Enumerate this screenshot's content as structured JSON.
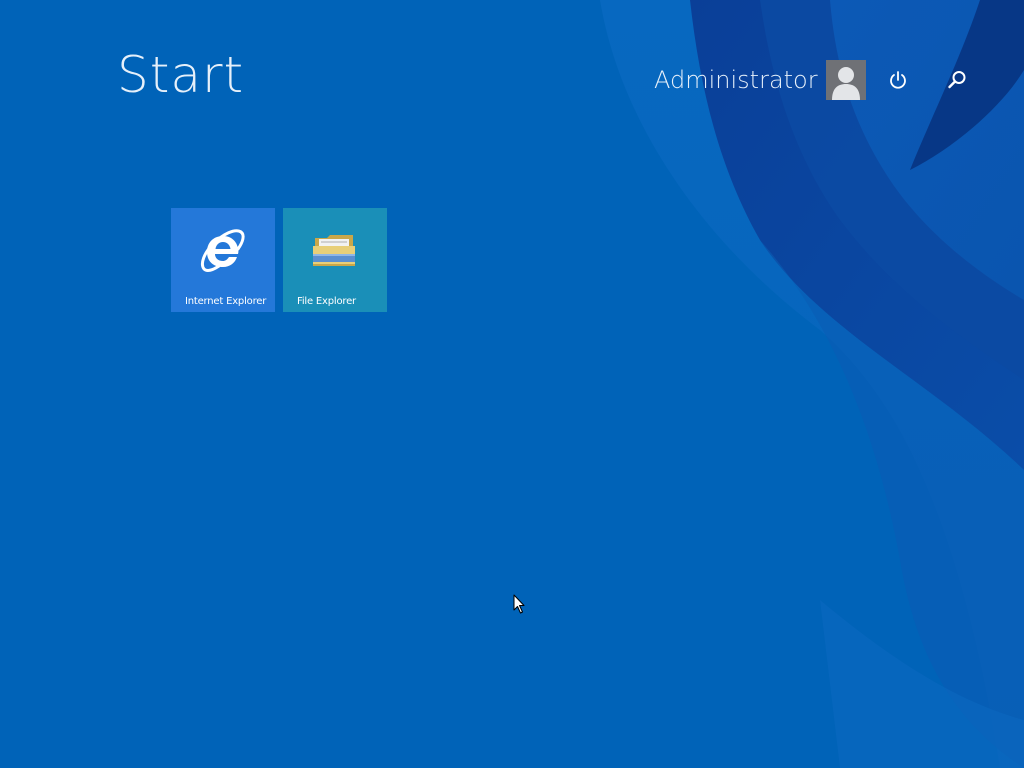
{
  "screen": {
    "title": "Start",
    "background_color": "#0063b8",
    "accent_ribbon_color": "#003a8c"
  },
  "user": {
    "name": "Administrator",
    "avatar_icon": "user-silhouette-icon"
  },
  "top_buttons": {
    "power_icon": "power-icon",
    "search_icon": "search-icon"
  },
  "tiles": [
    {
      "label": "Internet Explorer",
      "icon": "internet-explorer-icon",
      "color": "#2478d9"
    },
    {
      "label": "File Explorer",
      "icon": "folder-icon",
      "color": "#1a8fb8"
    }
  ]
}
